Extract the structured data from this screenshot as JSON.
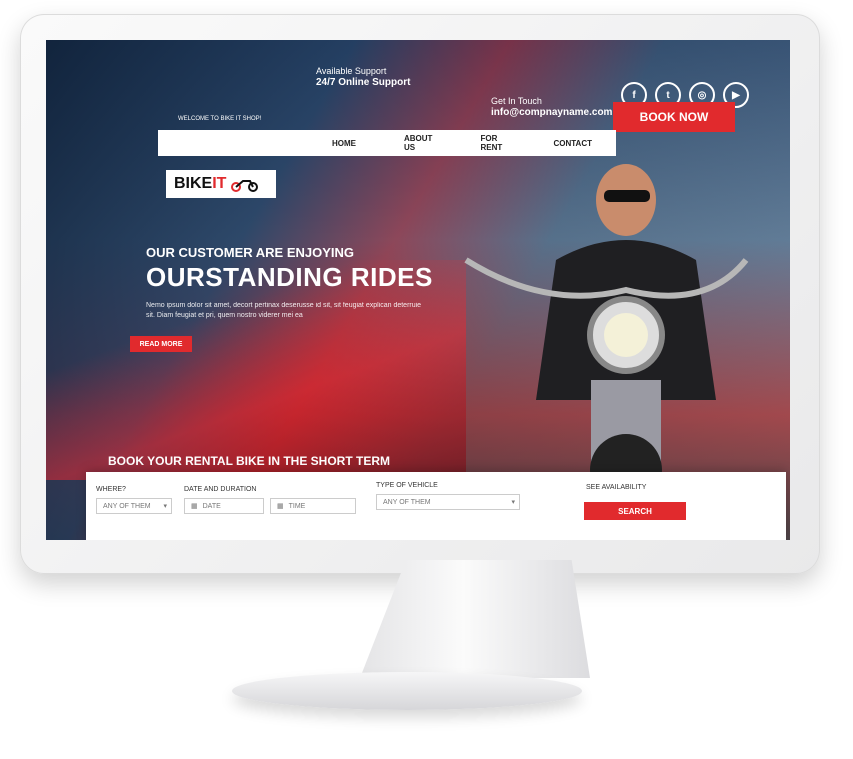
{
  "header": {
    "support_label": "Available Support",
    "support_value": "24/7 Online Support",
    "contact_label": "Get In Touch",
    "contact_value": "info@compnayname.com",
    "book_now": "BOOK NOW",
    "welcome": "WELCOME TO BIKE IT SHOP!",
    "social": [
      {
        "label": "f",
        "icon": "facebook-icon"
      },
      {
        "label": "t",
        "icon": "twitter-icon"
      },
      {
        "label": "◎",
        "icon": "instagram-icon"
      },
      {
        "label": "▶",
        "icon": "youtube-icon"
      }
    ]
  },
  "nav": {
    "items": [
      "HOME",
      "ABOUT US",
      "FOR RENT",
      "CONTACT"
    ]
  },
  "logo": {
    "text_main": "BIKE",
    "text_accent": "IT"
  },
  "hero": {
    "subtitle": "OUR CUSTOMER ARE ENJOYING",
    "title": "OURSTANDING RIDES",
    "description": "Nemo ipsum dolor sit amet, decort pertinax deserusse id sit, sit feugiat explican deterruie sit. Diam feugiat et pri, quem nostro viderer mei ea",
    "read_more": "READ MORE",
    "strapline": "BOOK YOUR RENTAL BIKE IN THE SHORT TERM"
  },
  "search": {
    "where_label": "WHERE?",
    "where_value": "ANY OF THEM",
    "date_label": "DATE AND DURATION",
    "date_placeholder": "DATE",
    "time_placeholder": "TIME",
    "vehicle_label": "TYPE OF VEHICLE",
    "vehicle_value": "ANY OF THEM",
    "availability_label": "SEE AVAILABILITY",
    "search_button": "SEARCH"
  }
}
